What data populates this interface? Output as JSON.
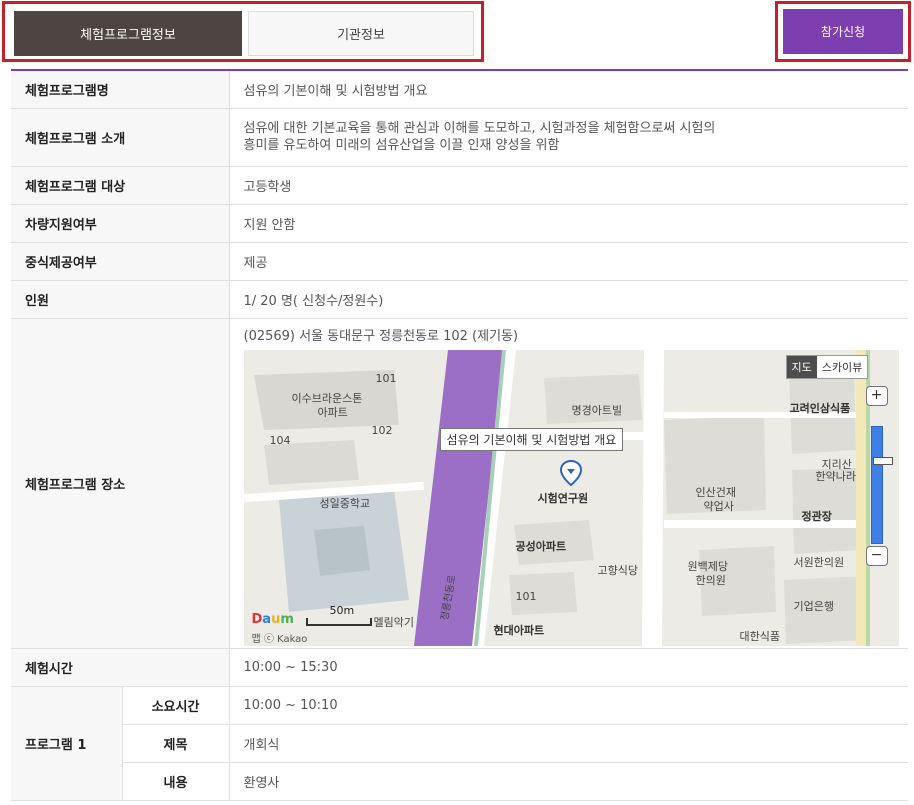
{
  "tabs": {
    "program_info": "체험프로그램정보",
    "org_info": "기관정보"
  },
  "apply_button": "참가신청",
  "rows": {
    "program_name": {
      "label": "체험프로그램명",
      "value": "섬유의 기본이해 및 시험방법 개요"
    },
    "program_intro": {
      "label": "체험프로그램 소개",
      "line1": "섬유에 대한 기본교육을 통해 관심과 이해를 도모하고, 시험과정을 체험함으로써 시험의",
      "line2": "흥미를 유도하여 미래의 섬유산업을 이끌 인재 양성을 위함"
    },
    "target": {
      "label": "체험프로그램 대상",
      "value": "고등학생"
    },
    "vehicle": {
      "label": "차량지원여부",
      "value": "지원 안함"
    },
    "meal": {
      "label": "중식제공여부",
      "value": "제공"
    },
    "people": {
      "label": "인원",
      "value": "1/ 20 명( 신청수/정원수)"
    },
    "location": {
      "label": "체험프로그램 장소",
      "address": "(02569) 서울 동대문구 정릉천동로 102 (제기동)"
    },
    "time": {
      "label": "체험시간",
      "value": "10:00 ~ 15:30"
    },
    "program1": {
      "label": "프로그램 1",
      "duration_label": "소요시간",
      "duration_value": "10:00 ~ 10:10",
      "title_label": "제목",
      "title_value": "개회식",
      "content_label": "내용",
      "content_value": "환영사"
    }
  },
  "map": {
    "callout": "섬유의 기본이해 및 시험방법 개요",
    "map_type_map": "지도",
    "map_type_sky": "스카이뷰",
    "zoom_in": "+",
    "zoom_out": "−",
    "scale": "50m",
    "brand": {
      "d": "D",
      "a": "a",
      "u": "u",
      "m": "m"
    },
    "brand_sub": "맵 ⓒ Kakao",
    "labels": {
      "apt1_a": "이수브라운스톤",
      "apt1_b": "아파트",
      "b101": "101",
      "b102": "102",
      "b104": "104",
      "school": "성일중학교",
      "villa": "명경아트빌",
      "institute": "시험연구원",
      "pharmacy_a": "인산건재",
      "pharmacy_b": "약업사",
      "apt2": "공성아파트",
      "restaurant": "고향식당",
      "herb_a": "원백제당",
      "herb_b": "한의원",
      "b101b": "101",
      "hyundai": "현대아파트",
      "melody": "멜림악기",
      "korea_food": "고려인삼식품",
      "jiri_a": "지리산",
      "jiri_b": "한약나라",
      "jeonggwan": "정관장",
      "seowon": "서원한의원",
      "bank": "기업은행",
      "daehan": "대한식품",
      "road": "정릉천동로"
    }
  },
  "colors": {
    "accent": "#7d3fb0",
    "tab_active_bg": "#4d4541",
    "highlight_border": "#c8202a",
    "header_bg": "#f7f7f7"
  }
}
